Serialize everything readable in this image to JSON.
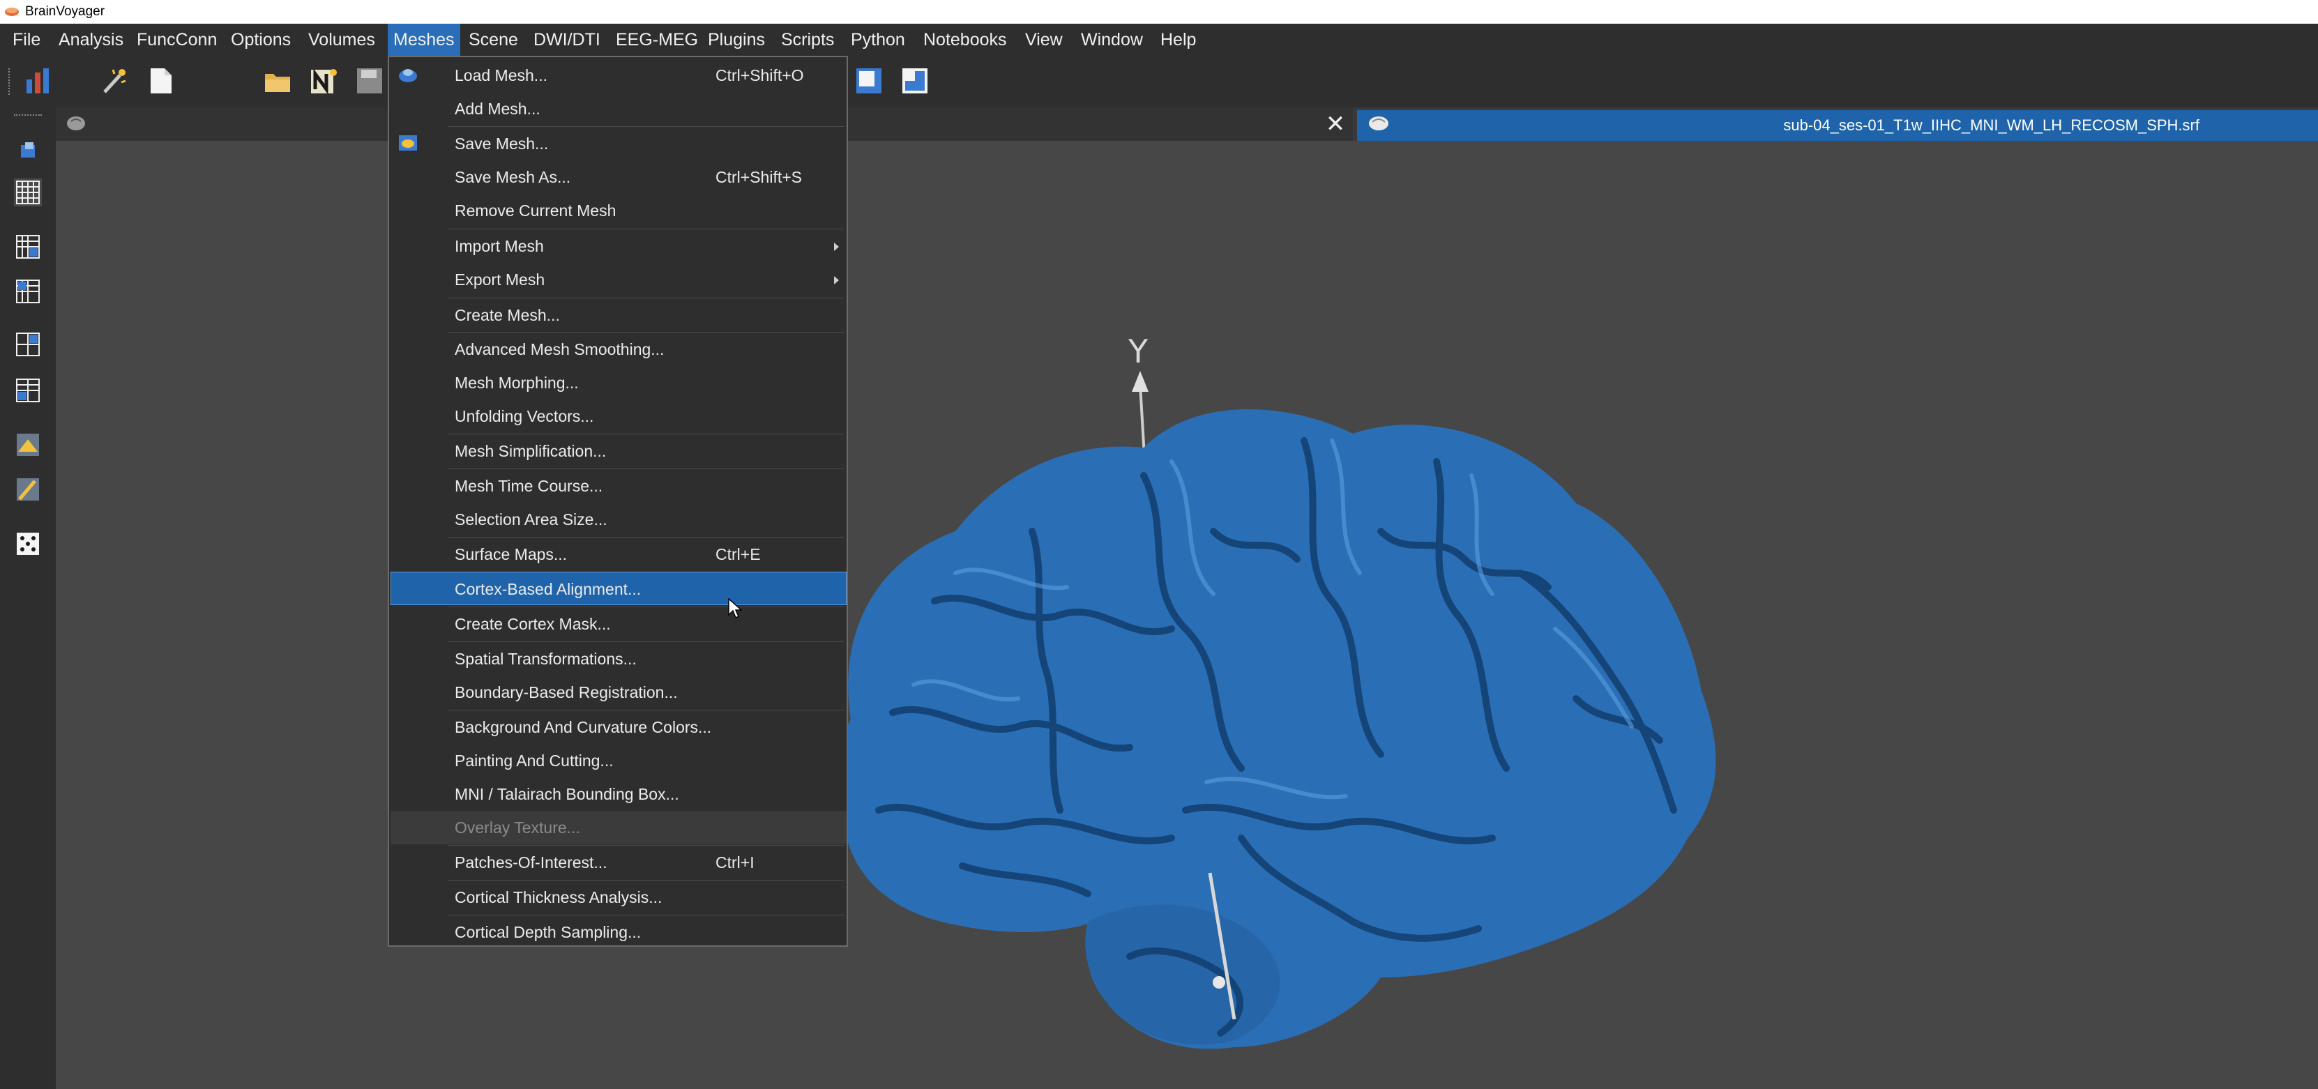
{
  "window": {
    "title": "BrainVoyager"
  },
  "menubar": [
    {
      "label": "File"
    },
    {
      "label": "Analysis"
    },
    {
      "label": "FuncConn"
    },
    {
      "label": "Options"
    },
    {
      "label": "Volumes"
    },
    {
      "label": "Meshes"
    },
    {
      "label": "Scene"
    },
    {
      "label": "DWI/DTI"
    },
    {
      "label": "EEG-MEG"
    },
    {
      "label": "Plugins"
    },
    {
      "label": "Scripts"
    },
    {
      "label": "Python"
    },
    {
      "label": "Notebooks"
    },
    {
      "label": "View"
    },
    {
      "label": "Window"
    },
    {
      "label": "Help"
    }
  ],
  "active_menu": "Meshes",
  "document": {
    "tab_title": "sub-04_ses-01_T1w_IIHC_MNI_WM_LH_RECOSM_SPH.srf",
    "close_glyph": "✕"
  },
  "scene": {
    "axis_label": "Y",
    "mesh_color": "#2a6fb5"
  },
  "meshes_menu": [
    {
      "label": "Load Mesh...",
      "shortcut": "Ctrl+Shift+O",
      "icon": "load-mesh-icon"
    },
    {
      "label": "Add Mesh..."
    },
    {
      "label": "Save Mesh...",
      "icon": "save-mesh-icon"
    },
    {
      "label": "Save Mesh As...",
      "shortcut": "Ctrl+Shift+S"
    },
    {
      "label": "Remove Current Mesh"
    },
    {
      "label": "Import Mesh",
      "submenu": true
    },
    {
      "label": "Export Mesh",
      "submenu": true
    },
    {
      "label": "Create Mesh..."
    },
    {
      "label": "Advanced Mesh Smoothing..."
    },
    {
      "label": "Mesh Morphing..."
    },
    {
      "label": "Unfolding Vectors..."
    },
    {
      "label": "Mesh Simplification..."
    },
    {
      "label": "Mesh Time Course..."
    },
    {
      "label": "Selection Area Size..."
    },
    {
      "label": "Surface Maps...",
      "shortcut": "Ctrl+E"
    },
    {
      "label": "Cortex-Based Alignment...",
      "highlighted": true
    },
    {
      "label": "Create Cortex Mask..."
    },
    {
      "label": "Spatial Transformations..."
    },
    {
      "label": "Boundary-Based Registration..."
    },
    {
      "label": "Background And Curvature Colors..."
    },
    {
      "label": "Painting And Cutting..."
    },
    {
      "label": "MNI / Talairach Bounding Box..."
    },
    {
      "label": "Overlay Texture...",
      "disabled": true
    },
    {
      "label": "Patches-Of-Interest...",
      "shortcut": "Ctrl+I"
    },
    {
      "label": "Cortical Thickness Analysis..."
    },
    {
      "label": "Cortical Depth Sampling..."
    }
  ],
  "colors": {
    "accent": "#1f63ab",
    "menubar_bg": "#2e2e2e",
    "viewport_bg": "#474747"
  }
}
